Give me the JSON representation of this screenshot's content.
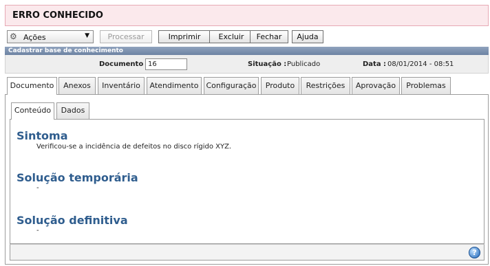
{
  "window": {
    "title": "ERRO CONHECIDO"
  },
  "toolbar": {
    "actions_label": "Ações",
    "gear_icon": "gear-icon",
    "buttons": {
      "processar": "Processar",
      "imprimir": "Imprimir",
      "excluir": "Excluir",
      "fechar": "Fechar",
      "ajuda": "Ajuda"
    }
  },
  "section": {
    "title": "Cadastrar base de conhecimento"
  },
  "info": {
    "documento_label": "Documento :",
    "documento_value": "16",
    "situacao_label": "Situação :",
    "situacao_value": "Publicado",
    "data_label": "Data :",
    "data_value": "08/01/2014 - 08:51"
  },
  "tabs": [
    "Documento",
    "Anexos",
    "Inventário",
    "Atendimento",
    "Configuração",
    "Produto",
    "Restrições",
    "Aprovação",
    "Problemas"
  ],
  "subtabs": [
    "Conteúdo",
    "Dados"
  ],
  "content": {
    "sintoma_title": "Sintoma",
    "sintoma_text": "Verificou-se a incidência de defeitos no disco rígido XYZ.",
    "solucao_temp_title": "Solução temporária",
    "solucao_temp_text": "-",
    "solucao_def_title": "Solução definitiva",
    "solucao_def_text": "-"
  },
  "colors": {
    "heading": "#2f5d8e",
    "title_bg": "#fbe9ec",
    "section_head": "#6d83a3"
  }
}
